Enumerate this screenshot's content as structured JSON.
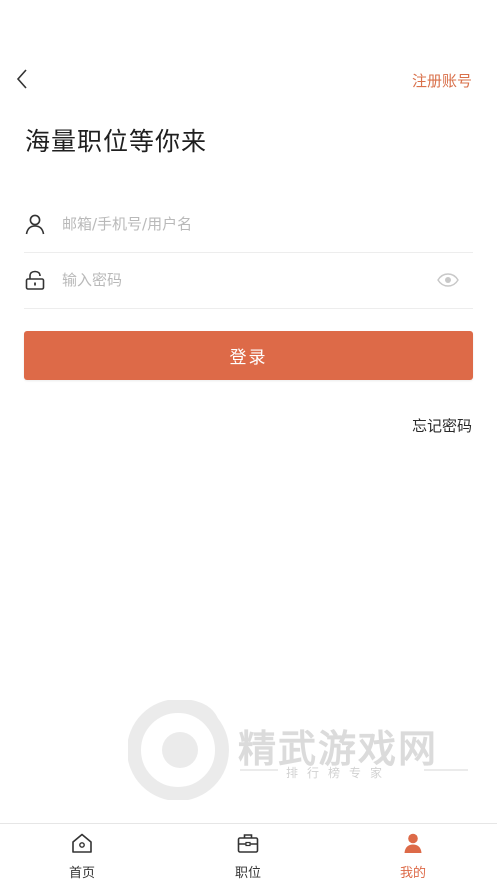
{
  "header": {
    "register_label": "注册账号",
    "headline": "海量职位等你来"
  },
  "form": {
    "username_placeholder": "邮箱/手机号/用户名",
    "username_value": "",
    "password_placeholder": "输入密码",
    "password_value": "",
    "login_label": "登录",
    "forgot_label": "忘记密码"
  },
  "watermark": {
    "title": "精武游戏网",
    "subtitle": "排行榜专家"
  },
  "tabbar": {
    "items": [
      {
        "label": "首页",
        "icon": "home-icon",
        "active": false
      },
      {
        "label": "职位",
        "icon": "briefcase-icon",
        "active": false
      },
      {
        "label": "我的",
        "icon": "person-icon",
        "active": true
      }
    ]
  },
  "colors": {
    "accent": "#dd6a48",
    "register_link": "#d9704a",
    "placeholder": "#b9b9b9"
  }
}
